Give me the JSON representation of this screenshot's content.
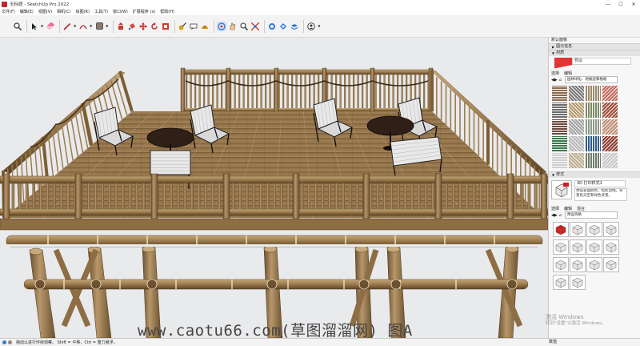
{
  "window": {
    "title": "无标题 - SketchUp Pro 2022",
    "controls": [
      "—",
      "☐",
      "✕"
    ]
  },
  "menu": [
    "文件(F)",
    "编辑(E)",
    "视图(V)",
    "相机(C)",
    "绘图(R)",
    "工具(T)",
    "窗口(W)",
    "扩展程序 (x)",
    "帮助(H)"
  ],
  "toolbar": {
    "icons": [
      "search-icon",
      "select-arrow-icon",
      "eraser-icon",
      "pencil-icon",
      "arc-icon",
      "paint-bucket-icon",
      "pushpull-icon",
      "rotate-icon",
      "move-icon",
      "refresh-icon",
      "tape-measure-icon",
      "text-icon",
      "protractor-icon",
      "orbit-icon",
      "pan-icon",
      "zoom-icon",
      "zoom-extents-icon",
      "warehouse-icon",
      "extension-icon",
      "layers-icon",
      "user-icon"
    ]
  },
  "tray": {
    "title": "默认面板",
    "entity_info_label": "图元信息",
    "materials_label": "材质",
    "material_name_placeholder": "预设",
    "tab_select": "选择",
    "tab_edit": "编辑",
    "library": "园林绿化、地被层和植被",
    "styles_label": "样式",
    "style_name": "3D 打印样式1",
    "style_desc": "预设表面颜色，粒影边线。背景色天空和绿色背景。",
    "styles_tab_select": "选择",
    "styles_tab_edit": "编辑",
    "styles_tab_mix": "混合",
    "styles_library": "预设风格"
  },
  "status": {
    "hint": "拖动以进行环绕观察。 Shift = 平移，Ctrl = 重力悬浮。",
    "measure_label": "数值"
  },
  "watermark": "www.caotu66.com(草图溜溜网) 图A",
  "activation": {
    "line1": "激活 Windows",
    "line2": "转到\"设置\"以激活 Windows。"
  },
  "colors": {
    "wood": "#a3845a",
    "wood_dark": "#5b4424",
    "accent_red": "#e23434"
  }
}
